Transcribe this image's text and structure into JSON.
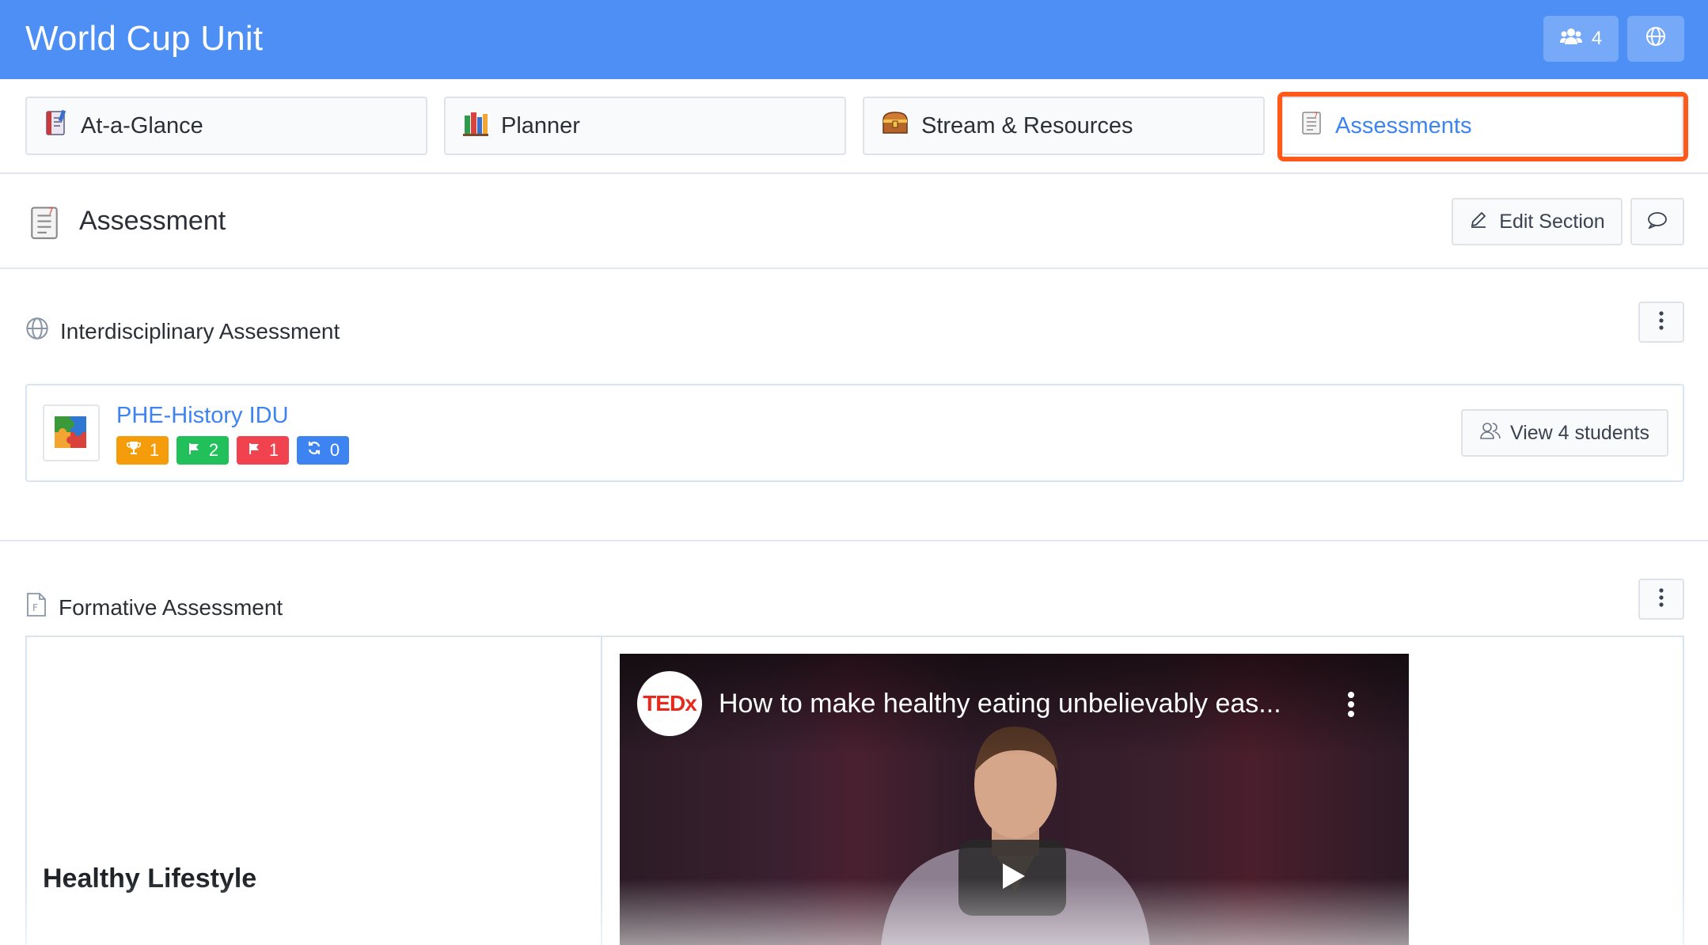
{
  "header": {
    "title": "World Cup Unit",
    "people_count": "4",
    "people_icon": "users-icon",
    "globe_icon": "globe-icon"
  },
  "tabs": [
    {
      "label": "At-a-Glance",
      "icon": "notebook-icon"
    },
    {
      "label": "Planner",
      "icon": "books-icon"
    },
    {
      "label": "Stream & Resources",
      "icon": "treasure-chest-icon"
    },
    {
      "label": "Assessments",
      "icon": "clipboard-icon",
      "active": true
    }
  ],
  "section": {
    "title": "Assessment",
    "edit_label": "Edit Section"
  },
  "interdisciplinary": {
    "title": "Interdisciplinary Assessment",
    "item": {
      "name": "PHE-History IDU",
      "badges": [
        {
          "icon": "trophy-icon",
          "value": "1",
          "color": "#f59c0b"
        },
        {
          "icon": "flag-icon",
          "value": "2",
          "color": "#22c05a"
        },
        {
          "icon": "flag-icon",
          "value": "1",
          "color": "#f0434f"
        },
        {
          "icon": "refresh-icon",
          "value": "0",
          "color": "#3d84f2"
        }
      ],
      "students_label": "View 4 students"
    }
  },
  "formative": {
    "title": "Formative Assessment",
    "item_name": "Healthy Lifestyle",
    "video": {
      "channel": "TEDx",
      "title": "How to make healthy eating unbelievably eas..."
    }
  },
  "colors": {
    "header_bg": "#4d8ff5",
    "link": "#3d84f2",
    "highlight": "#ff5a1a"
  }
}
